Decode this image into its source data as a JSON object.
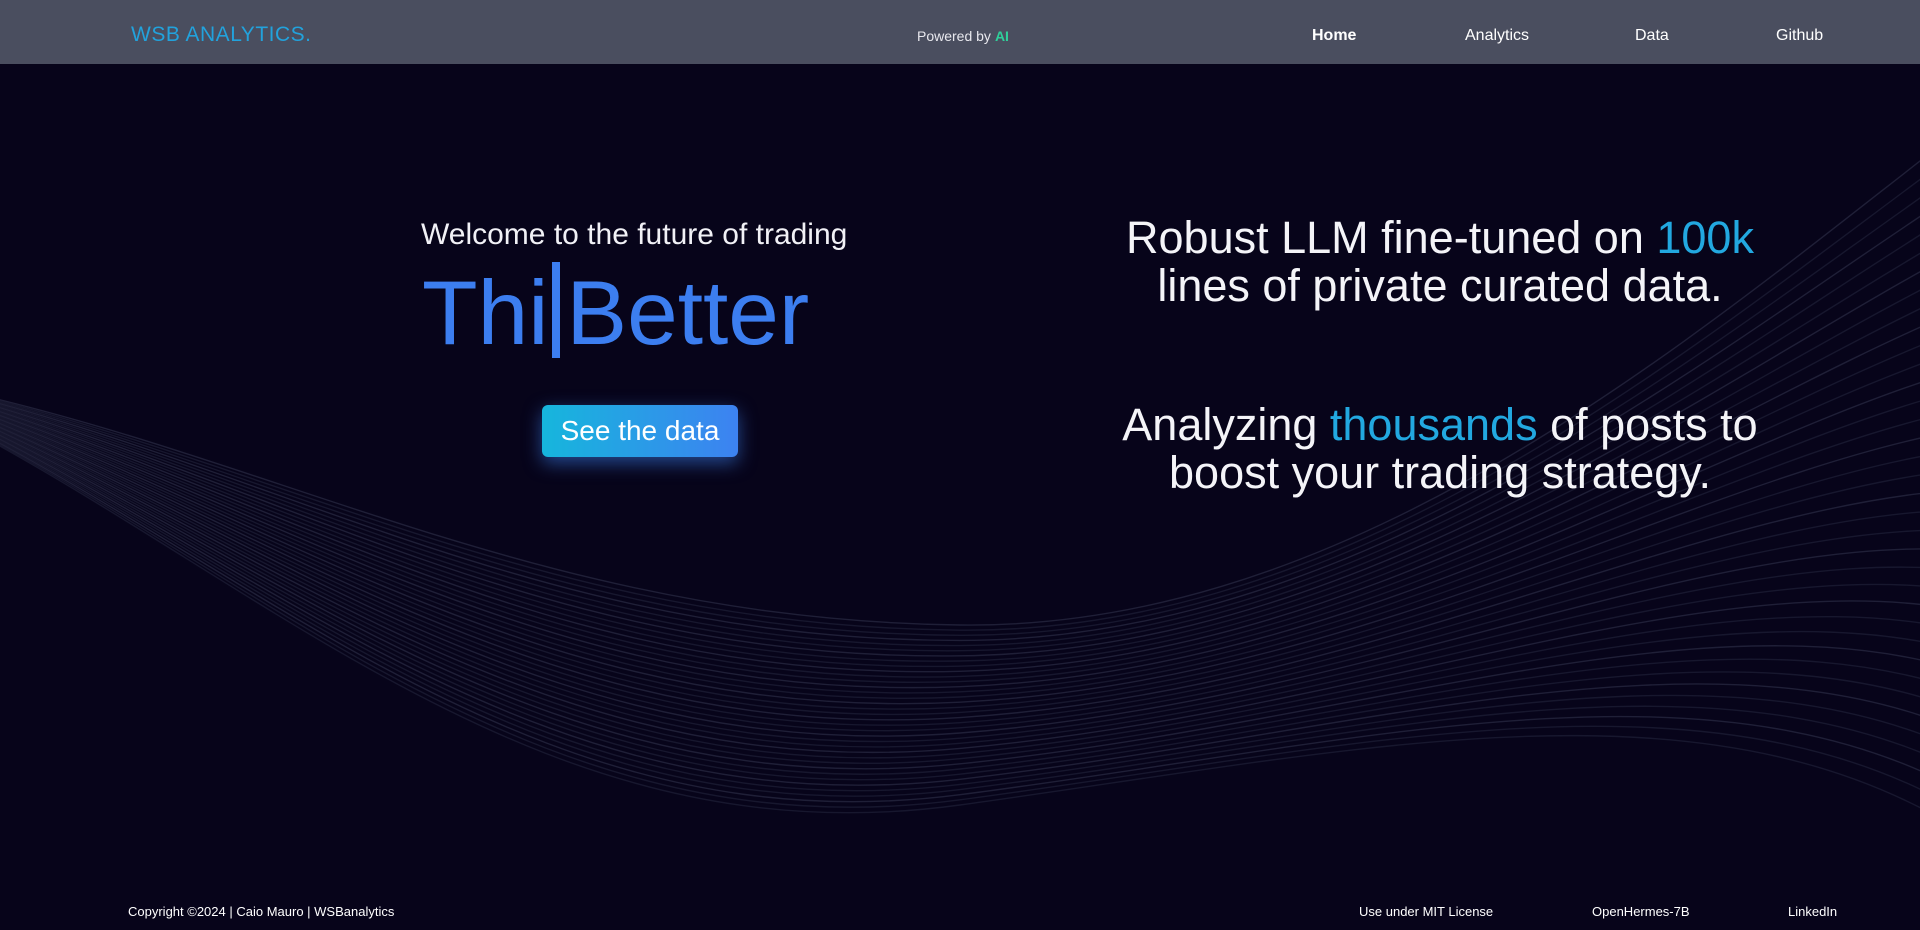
{
  "header": {
    "brand": "WSB ANALYTICS.",
    "powered_by_prefix": "Powered by",
    "powered_by_highlight": "AI",
    "nav": [
      {
        "label": "Home"
      },
      {
        "label": "Analytics"
      },
      {
        "label": "Data"
      },
      {
        "label": "Github"
      }
    ]
  },
  "hero": {
    "welcome": "Welcome to the future of trading",
    "typed_before_cursor": "Thi",
    "typed_after_cursor": "Better",
    "cta_label": "See the data"
  },
  "claims": [
    {
      "before": "Robust LLM fine-tuned on ",
      "highlight": "100k",
      "after": " lines of private curated data."
    },
    {
      "before": "Analyzing ",
      "highlight": "thousands",
      "after": " of posts to boost your trading strategy."
    }
  ],
  "footer": {
    "copyright": "Copyright ©2024 | Caio Mauro | WSBanalytics",
    "links": [
      {
        "label": "Use under MIT License"
      },
      {
        "label": "OpenHermes-7B"
      },
      {
        "label": "LinkedIn"
      }
    ]
  },
  "colors": {
    "background": "#07041a",
    "navbar": "#4a4e5f",
    "brand": "#22a2dc",
    "accent_blue": "#3c7ef0",
    "highlight_cyan": "#22a8e0",
    "ai_green": "#2fcf9a"
  }
}
